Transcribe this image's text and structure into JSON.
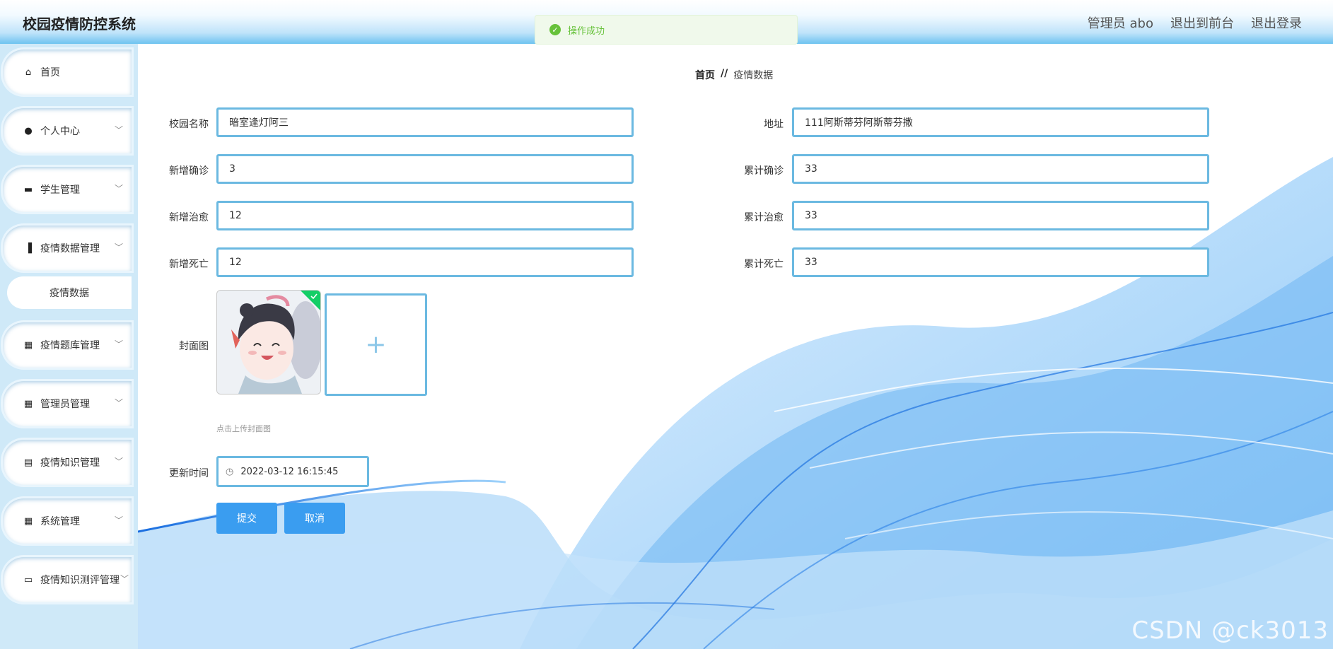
{
  "header": {
    "title": "校园疫情防控系统",
    "links": [
      "管理员 abo",
      "退出到前台",
      "退出登录"
    ]
  },
  "toast": {
    "message": "操作成功"
  },
  "sidebar": {
    "items": [
      {
        "label": "首页",
        "icon": "home-icon",
        "has_submenu": false
      },
      {
        "label": "个人中心",
        "icon": "user-icon",
        "has_submenu": true
      },
      {
        "label": "学生管理",
        "icon": "briefcase-icon",
        "has_submenu": true
      },
      {
        "label": "疫情数据管理",
        "icon": "bar-chart-icon",
        "has_submenu": true
      },
      {
        "label": "疫情题库管理",
        "icon": "grid-icon",
        "has_submenu": true
      },
      {
        "label": "管理员管理",
        "icon": "grid-icon",
        "has_submenu": true
      },
      {
        "label": "疫情知识管理",
        "icon": "clipboard-icon",
        "has_submenu": true
      },
      {
        "label": "系统管理",
        "icon": "grid-icon",
        "has_submenu": true
      },
      {
        "label": "疫情知识测评管理",
        "icon": "monitor-icon",
        "has_submenu": true
      }
    ],
    "subitem": "疫情数据"
  },
  "breadcrumb": {
    "home": "首页",
    "separator": "//",
    "current": "疫情数据"
  },
  "form": {
    "campus_name": {
      "label": "校园名称",
      "value": "暗室逢灯阿三"
    },
    "address": {
      "label": "地址",
      "value": "111阿斯蒂芬阿斯蒂芬撒"
    },
    "new_confirmed": {
      "label": "新增确诊",
      "value": "3"
    },
    "total_confirmed": {
      "label": "累计确诊",
      "value": "33"
    },
    "new_cured": {
      "label": "新增治愈",
      "value": "12"
    },
    "total_cured": {
      "label": "累计治愈",
      "value": "33"
    },
    "new_deaths": {
      "label": "新增死亡",
      "value": "12"
    },
    "total_deaths": {
      "label": "累计死亡",
      "value": "33"
    },
    "cover": {
      "label": "封面图",
      "tip": "点击上传封面图"
    },
    "update_time": {
      "label": "更新时间",
      "value": "2022-03-12 16:15:45"
    },
    "submit_label": "提交",
    "cancel_label": "取消"
  },
  "watermark": "CSDN @ck3013",
  "colors": {
    "accent": "#3a9df0",
    "input_border": "#6bb9e1",
    "success": "#67c23a",
    "sidebar_bg": "#cfe9f8"
  }
}
